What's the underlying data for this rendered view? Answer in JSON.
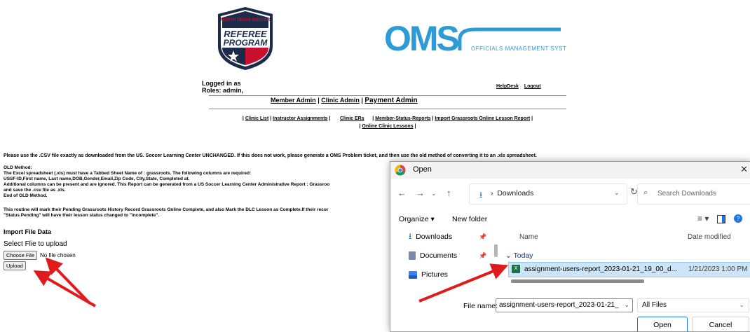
{
  "logos": {
    "referee_top": "NORTH TEXAS SOCCER",
    "referee_line1": "REFEREE",
    "referee_line2": "PROGRAM",
    "oms_big": "OMS",
    "oms_tagline": "OFFICIALS MANAGEMENT SYSTEMS"
  },
  "header": {
    "logged_in": "Logged in as",
    "roles": "Roles: admin,",
    "helpdesk": "HelpDesk",
    "logout": "Logout",
    "admin_nav": [
      "Member Admin",
      "Clinic Admin",
      "Payment Admin"
    ],
    "sub_nav_row1": [
      "Clinic List",
      "Instructor Assignments",
      "Clinic ERs",
      "Member-Status-Reports",
      "Import Grassroots Online Lesson Report"
    ],
    "sub_nav_row2": [
      "Online Clinic Lessons"
    ]
  },
  "body": {
    "instructions": "Please use the .CSV file exactly as downloaded from the US. Soccer Learning Center UNCHANGED. If this does not work, please generate a OMS Problem ticket, and then use the old method of converting it to an .xls spreadsheet.",
    "old_method": [
      "OLD Method:",
      "The Excel spreadsheet (.xls) must have a Tabbed Sheet Name of : grassroots. The following columns are required:",
      "USSF-ID,First name, Last name,DOB,Gender,Email,Zip Code, City,State, Completed at.",
      "Additional columns can be present and are ignored. This Report can be generated from a US Soccer Learning Center Administrative Report : Grassroo",
      "and save the .csv file as .xls.",
      "End of OLD Method."
    ],
    "routine": [
      "This routine will mark their Pending Grassroots History Record Grassroots Online Complete, and also Mark the DLC Lesson as Complete.If their recor",
      "\"Status Pending\" will have their lesson status changed to \"incomplete\"."
    ],
    "import_heading": "Import File Data",
    "select_label": "Select Flie to upload",
    "choose_file": "Choose File",
    "no_file": "No file chosen",
    "upload": "Upload"
  },
  "dialog": {
    "title": "Open",
    "path": "Downloads",
    "search_placeholder": "Search Downloads",
    "organize": "Organize",
    "new_folder": "New folder",
    "nav_items": [
      "Downloads",
      "Documents",
      "Pictures"
    ],
    "columns": {
      "name": "Name",
      "date": "Date modified"
    },
    "group": "Today",
    "file": {
      "name": "assignment-users-report_2023-01-21_19_00_d...",
      "date": "1/21/2023 1:00 PM"
    },
    "file_name_label": "File name:",
    "file_name_value": "assignment-users-report_2023-01-21_",
    "file_type": "All Files",
    "open": "Open",
    "cancel": "Cancel"
  },
  "colors": {
    "oms_blue": "#2d9bd5",
    "arrow_red": "#e01b1b",
    "logo_navy": "#1c2b4a",
    "logo_red": "#c8102e"
  }
}
